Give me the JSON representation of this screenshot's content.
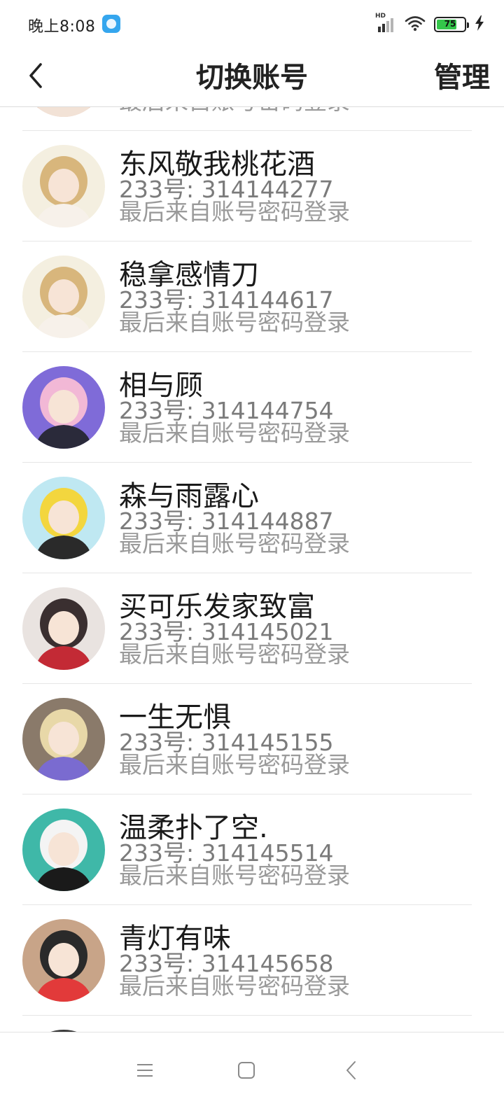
{
  "status_bar": {
    "time": "晚上8:08",
    "hd_label": "HD",
    "battery_level": "75",
    "battery_percent": 75,
    "app_icon": "chat-bubble-icon",
    "icons": [
      "signal-icon",
      "wifi-icon",
      "battery-icon",
      "charging-bolt-icon"
    ]
  },
  "header": {
    "title": "切换账号",
    "manage_label": "管理",
    "back_icon": "chevron-left-icon"
  },
  "accounts": [
    {
      "name": "",
      "id": "",
      "login": "最后来自账号密码登录",
      "avatar_colors": [
        "#e8c7b8",
        "#c98f7a",
        "#f2e2d6"
      ]
    },
    {
      "name": "东风敬我桃花酒",
      "id": "233号: 314144277",
      "login": "最后来自账号密码登录",
      "avatar_colors": [
        "#f4efe0",
        "#d8b67c",
        "#f7f1ea"
      ]
    },
    {
      "name": "稳拿感情刀",
      "id": "233号: 314144617",
      "login": "最后来自账号密码登录",
      "avatar_colors": [
        "#f4efe0",
        "#d8b67c",
        "#f7f1ea"
      ]
    },
    {
      "name": "相与顾",
      "id": "233号: 314144754",
      "login": "最后来自账号密码登录",
      "avatar_colors": [
        "#7f6bd8",
        "#f2b8d6",
        "#2a2a3a"
      ]
    },
    {
      "name": "森与雨露心",
      "id": "233号: 314144887",
      "login": "最后来自账号密码登录",
      "avatar_colors": [
        "#bfe8f2",
        "#f3d63e",
        "#2a2a2a"
      ]
    },
    {
      "name": "买可乐发家致富",
      "id": "233号: 314145021",
      "login": "最后来自账号密码登录",
      "avatar_colors": [
        "#e9e3e0",
        "#3a2f30",
        "#c32a35"
      ]
    },
    {
      "name": "一生无惧",
      "id": "233号: 314145155",
      "login": "最后来自账号密码登录",
      "avatar_colors": [
        "#8a7a6a",
        "#e8d8a8",
        "#7a6bd0"
      ]
    },
    {
      "name": "温柔扑了空.",
      "id": "233号: 314145514",
      "login": "最后来自账号密码登录",
      "avatar_colors": [
        "#3fb8a8",
        "#f4f4f4",
        "#1a1a1a"
      ]
    },
    {
      "name": "青灯有味",
      "id": "233号: 314145658",
      "login": "最后来自账号密码登录",
      "avatar_colors": [
        "#c8a488",
        "#2a2a2a",
        "#e23a3a"
      ]
    },
    {
      "name": "",
      "id": "",
      "login": "",
      "avatar_colors": [
        "#3a3a3a",
        "#6a6a6a",
        "#9a9a9a"
      ]
    }
  ],
  "nav_bar": {
    "buttons": [
      "menu-icon",
      "home-icon",
      "back-icon"
    ]
  }
}
